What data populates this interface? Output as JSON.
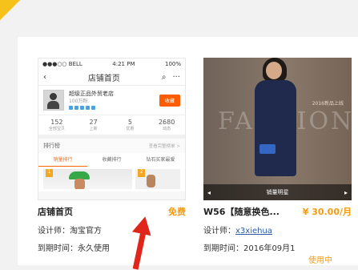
{
  "templates": [
    {
      "phone": {
        "status": {
          "carrier": "●●●○○ BELL",
          "time": "4:21 PM",
          "battery": "100%"
        },
        "nav": {
          "back": "‹",
          "title": "店铺首页",
          "search": "⌕",
          "more": "···"
        },
        "shop": {
          "name": "超级正品外贸老店",
          "sub": "100万粉",
          "follow": "收藏"
        },
        "stats": [
          {
            "value": "152",
            "label": "全部宝贝"
          },
          {
            "value": "27",
            "label": "上新"
          },
          {
            "value": "5",
            "label": "优惠"
          },
          {
            "value": "2680",
            "label": "动态"
          }
        ],
        "rank": {
          "title": "排行榜",
          "more": "查看完整榜单 >"
        },
        "tabs": [
          "销量排行",
          "收藏排行",
          "钻石买家最爱"
        ],
        "prod_ranks": [
          "1",
          "2"
        ]
      },
      "title": "店铺首页",
      "price": "免费",
      "designer_label": "设计师：",
      "designer": "淘宝官方",
      "expiry_label": "到期时间：",
      "expiry": "永久使用"
    },
    {
      "photo": {
        "watermark": "FASHION",
        "side_text": "2016新品上线",
        "bottom": "销量明星"
      },
      "title": "W56【随意换色...",
      "price": "¥ 30.00/月",
      "designer_label": "设计师：",
      "designer": "x3xiehua",
      "expiry_label": "到期时间：",
      "expiry": "2016年09月1",
      "badge": "使用中"
    }
  ],
  "colors": {
    "accent": "#f39c12",
    "link": "#2b5aa8",
    "arrow": "#e0251b",
    "phone_orange": "#ff5b00"
  }
}
